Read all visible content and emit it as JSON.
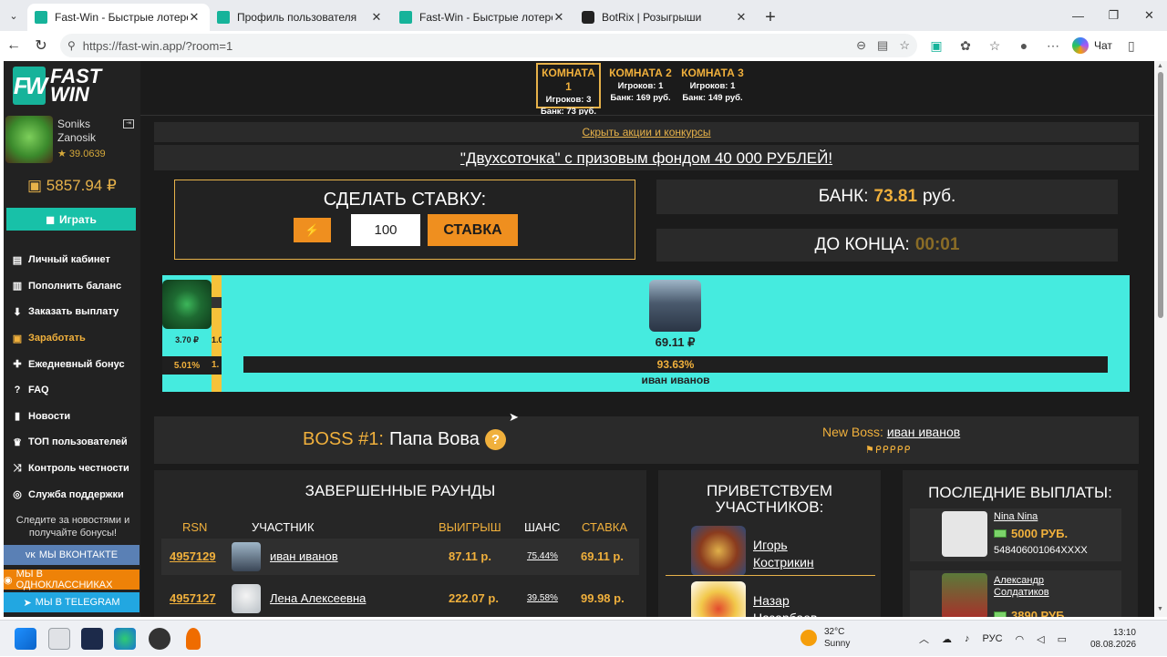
{
  "browser": {
    "tabs": [
      {
        "label": "Fast-Win - Быстрые лотереи! Ком",
        "active": true
      },
      {
        "label": "Профиль пользователя",
        "active": false
      },
      {
        "label": "Fast-Win - Быстрые лотереи!",
        "active": false
      },
      {
        "label": "BotRix | Розыгрыши",
        "active": false
      }
    ],
    "url": "https://fast-win.app/?room=1",
    "chat_label": "Чат"
  },
  "site": {
    "logo_mark": "FW",
    "logo_text_1": "FAST",
    "logo_text_2": "WIN",
    "user": {
      "name_1": "Soniks",
      "name_2": "Zanosik",
      "rating": "★ 39.0639",
      "balance": "5857.94 ₽"
    },
    "play_label": "Играть",
    "menu": [
      {
        "label": "Личный кабинет",
        "icon": "briefcase-icon"
      },
      {
        "label": "Пополнить баланс",
        "icon": "wallet-icon"
      },
      {
        "label": "Заказать выплату",
        "icon": "download-icon"
      },
      {
        "label": "Заработать",
        "icon": "money-icon",
        "accent": true
      },
      {
        "label": "Ежедневный бонус",
        "icon": "gift-icon"
      },
      {
        "label": "FAQ",
        "icon": "question-icon"
      },
      {
        "label": "Новости",
        "icon": "bookmark-icon"
      },
      {
        "label": "ТОП пользователей",
        "icon": "trophy-icon"
      },
      {
        "label": "Контроль честности",
        "icon": "shuffle-icon"
      },
      {
        "label": "Служба поддержки",
        "icon": "globe-icon"
      }
    ],
    "follow_text": "Следите за новостями и получайте бонусы!",
    "social": {
      "vk": "МЫ ВКОНТАКТЕ",
      "ok": "МЫ В ОДНОКЛАССНИКАХ",
      "tg": "МЫ В TELEGRAM"
    },
    "rooms": [
      {
        "title": "КОМНАТА 1",
        "players": "Игроков: 3",
        "bank": "Банк: 73 руб.",
        "active": true
      },
      {
        "title": "КОМНАТА 2",
        "players": "Игроков: 1",
        "bank": "Банк: 169 руб.",
        "active": false
      },
      {
        "title": "КОМНАТА 3",
        "players": "Игроков: 1",
        "bank": "Банк: 149 руб.",
        "active": false
      }
    ],
    "hide_promos": "Скрыть акции и конкурсы",
    "promo": "\"Двухсоточка\" с призовым фондом 40 000 РУБЛЕЙ!",
    "bet": {
      "title": "СДЕЛАТЬ СТАВКУ:",
      "amount": "100",
      "submit": "СТАВКА"
    },
    "bank": {
      "label": "БАНК:",
      "value": "73.81",
      "unit": "руб."
    },
    "timer": {
      "label": "ДО КОНЦА:",
      "value": "00:01"
    },
    "roulette": {
      "players": [
        {
          "amount": "3.70 ₽",
          "chance": "5.01%",
          "share": 0.0501
        },
        {
          "amount": "1.0",
          "chance": "1.",
          "share": 0.0136
        },
        {
          "amount": "69.11 ₽",
          "chance": "93.63%",
          "name": "иван иванов",
          "share": 0.9363
        }
      ]
    },
    "boss": {
      "label": "BOSS #1:",
      "name": "Папа Вова",
      "help": "?",
      "new_boss_label": "New Boss:",
      "new_boss_name": "иван иванов",
      "flags": "⚑ᑭᑭᑭᑭᑭ"
    },
    "rounds": {
      "title": "ЗАВЕРШЕННЫЕ РАУНДЫ",
      "headers": {
        "id": "RSN",
        "player": "УЧАСТНИК",
        "win": "ВЫИГРЫШ",
        "chance": "ШАНС",
        "bet": "СТАВКА"
      },
      "rows": [
        {
          "id": "4957129",
          "name": "иван иванов",
          "win": "87.11 р.",
          "chance": "75.44%",
          "bet": "69.11 р."
        },
        {
          "id": "4957127",
          "name": "Лена Алексеевна",
          "win": "222.07 р.",
          "chance": "39.58%",
          "bet": "99.98 р."
        }
      ]
    },
    "welcome": {
      "title_1": "ПРИВЕТСТВУЕМ",
      "title_2": "УЧАСТНИКОВ:",
      "users": [
        {
          "name_1": "Игорь",
          "name_2": "Кострикин"
        },
        {
          "name_1": "Назар",
          "name_2": "Назарбаев"
        }
      ]
    },
    "payouts": {
      "title": "ПОСЛЕДНИЕ ВЫПЛАТЫ:",
      "items": [
        {
          "name_1": "Nina Nina",
          "name_2": "",
          "amount": "5000 РУБ.",
          "account": "548406001064XXXX"
        },
        {
          "name_1": "Александр",
          "name_2": "Солдатиков",
          "amount": "3890 РУБ.",
          "account": ""
        }
      ]
    }
  },
  "taskbar": {
    "weather_temp": "32°C",
    "weather_text": "Sunny",
    "lang": "РУС",
    "time": "13:10",
    "date": "08.08.2026"
  },
  "colors": {
    "accent": "#f0b03c",
    "teal": "#18c1a8",
    "roulette_bg": "#45ebdf",
    "page_bg": "#1b1b1b"
  }
}
